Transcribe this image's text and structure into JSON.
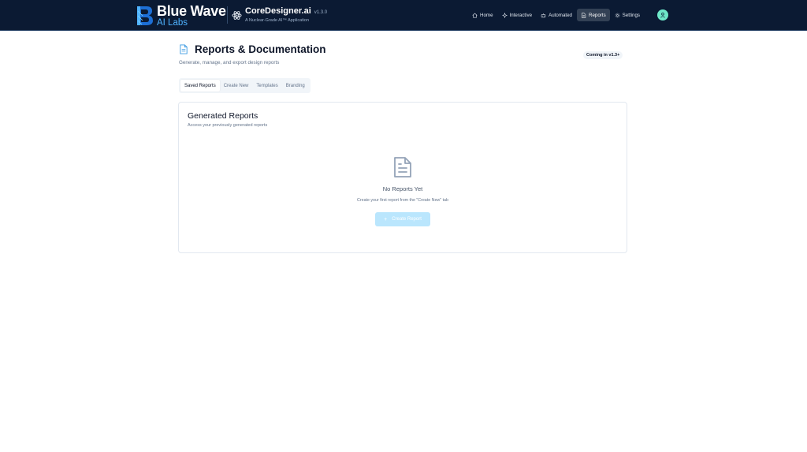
{
  "brand": {
    "name": "Blue Wave",
    "sub": "AI Labs"
  },
  "product": {
    "name": "CoreDesigner.ai",
    "version": "v1.3.0",
    "tagline": "A Nuclear-Grade AI™ Application"
  },
  "nav": {
    "items": [
      {
        "label": "Home",
        "icon": "home-icon"
      },
      {
        "label": "Interactive",
        "icon": "sparkle-icon"
      },
      {
        "label": "Automated",
        "icon": "bot-icon"
      },
      {
        "label": "Reports",
        "icon": "file-text-icon",
        "active": true
      },
      {
        "label": "Settings",
        "icon": "gear-icon"
      }
    ],
    "avatar_icon": "user-icon"
  },
  "page": {
    "title": "Reports & Documentation",
    "subtitle": "Generate, manage, and export design reports",
    "badge": "Coming in v1.3+"
  },
  "tabs": [
    {
      "label": "Saved Reports",
      "active": true
    },
    {
      "label": "Create New"
    },
    {
      "label": "Templates"
    },
    {
      "label": "Branding"
    }
  ],
  "card": {
    "title": "Generated Reports",
    "description": "Access your previously generated reports",
    "empty_title": "No Reports Yet",
    "empty_description": "Create your first report from the \"Create New\" tab",
    "button_label": "Create Report",
    "button_icon": "plus-icon"
  },
  "colors": {
    "header_bg": "#0b1a33",
    "brand_accent": "#4fb3ff",
    "avatar": "#6ee7c8",
    "button_disabled": "#bae6fd"
  }
}
